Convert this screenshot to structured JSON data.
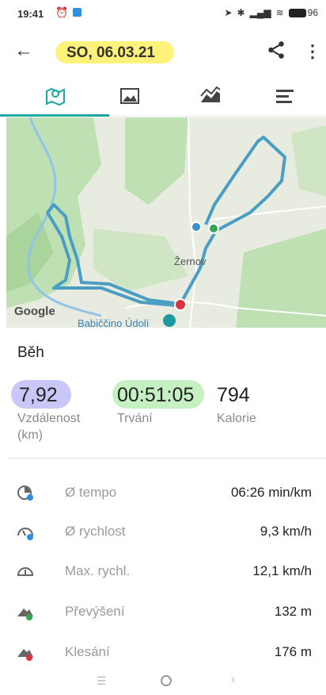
{
  "status": {
    "time": "19:41",
    "battery": "96"
  },
  "header": {
    "date": "SO, 06.03.21"
  },
  "tabs": [
    "map",
    "photos",
    "elevation",
    "splits"
  ],
  "map": {
    "label_town": "Žernov",
    "label_place": "Babiččino Údolí",
    "google": "Google"
  },
  "sport": "Běh",
  "stats": [
    {
      "value": "7,92",
      "label": "Vzdálenost (km)"
    },
    {
      "value": "00:51:05",
      "label": "Trvání"
    },
    {
      "value": "794",
      "label": "Kalorie"
    }
  ],
  "details": [
    {
      "label": "Ø tempo",
      "value": "06:26 min/km",
      "icon": "pace-icon"
    },
    {
      "label": "Ø rychlost",
      "value": "9,3 km/h",
      "icon": "speed-icon"
    },
    {
      "label": "Max. rychl.",
      "value": "12,1 km/h",
      "icon": "max-speed-icon"
    },
    {
      "label": "Převýšení",
      "value": "132 m",
      "icon": "elevation-gain-icon"
    },
    {
      "label": "Klesání",
      "value": "176 m",
      "icon": "elevation-loss-icon"
    }
  ],
  "colors": {
    "accent": "#18a6a0",
    "route": "#4a9ec3",
    "highlight_date": "#fff27a",
    "highlight_distance": "#c9c7f8",
    "highlight_duration": "#c4f0c2"
  }
}
